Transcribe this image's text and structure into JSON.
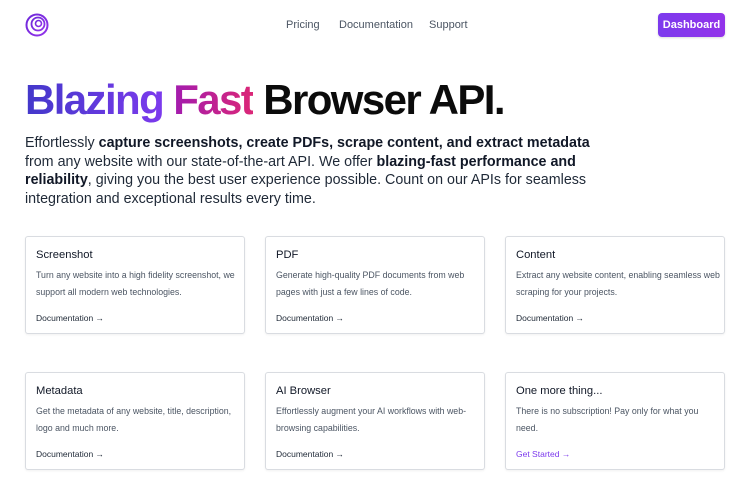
{
  "nav": {
    "logo_icon": "concentric-circles-logo",
    "links": [
      "Pricing",
      "Documentation",
      "Support"
    ],
    "dashboard_label": "Dashboard",
    "accent_color": "#7c3aed"
  },
  "hero": {
    "title_part1": "Blazing",
    "title_part2": "Fast",
    "title_part3": "Browser API.",
    "desc_1": "Effortlessly ",
    "desc_2": "capture screenshots, create PDFs, scrape content, and extract metadata",
    "desc_3": " from any website with our state-of-the-art API. We offer ",
    "desc_4": "blazing-fast performance and reliability",
    "desc_5": ", giving you the best user experience possible. Count on our APIs for seamless integration and exceptional results every time."
  },
  "cards": [
    {
      "title": "Screenshot",
      "desc": "Turn any website into a high fidelity screenshot, we support all modern web technologies.",
      "link": "Documentation →"
    },
    {
      "title": "PDF",
      "desc": "Generate high-quality PDF documents from web pages with just a few lines of code.",
      "link": "Documentation →"
    },
    {
      "title": "Content",
      "desc": "Extract any website content, enabling seamless web scraping for your projects.",
      "link": "Documentation →"
    },
    {
      "title": "Metadata",
      "desc": "Get the metadata of any website, title, description, logo and much more.",
      "link": "Documentation →"
    },
    {
      "title": "AI Browser",
      "desc": "Effortlessly augment your AI workflows with web-browsing capabilities.",
      "link": "Documentation →"
    },
    {
      "title": "One more thing...",
      "desc": "There is no subscription! Pay only for what you need.",
      "link": "Get Started →"
    }
  ]
}
